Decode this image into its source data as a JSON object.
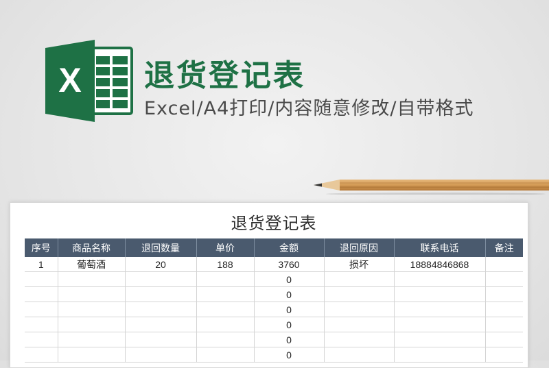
{
  "header": {
    "title": "退货登记表",
    "subtitle": "Excel/A4打印/内容随意修改/自带格式",
    "logo_letter": "X",
    "logo_icon": "excel-icon"
  },
  "decor": {
    "pencil_icon": "pencil-icon"
  },
  "colors": {
    "brand_green": "#1e7145",
    "header_bg": "#4a5a6e"
  },
  "sheet": {
    "title": "退货登记表",
    "columns": [
      "序号",
      "商品名称",
      "退回数量",
      "单价",
      "金额",
      "退回原因",
      "联系电话",
      "备注"
    ],
    "rows": [
      [
        "1",
        "葡萄酒",
        "20",
        "188",
        "3760",
        "损坏",
        "18884846868",
        ""
      ],
      [
        "",
        "",
        "",
        "",
        "0",
        "",
        "",
        ""
      ],
      [
        "",
        "",
        "",
        "",
        "0",
        "",
        "",
        ""
      ],
      [
        "",
        "",
        "",
        "",
        "0",
        "",
        "",
        ""
      ],
      [
        "",
        "",
        "",
        "",
        "0",
        "",
        "",
        ""
      ],
      [
        "",
        "",
        "",
        "",
        "0",
        "",
        "",
        ""
      ],
      [
        "",
        "",
        "",
        "",
        "0",
        "",
        "",
        ""
      ]
    ]
  }
}
